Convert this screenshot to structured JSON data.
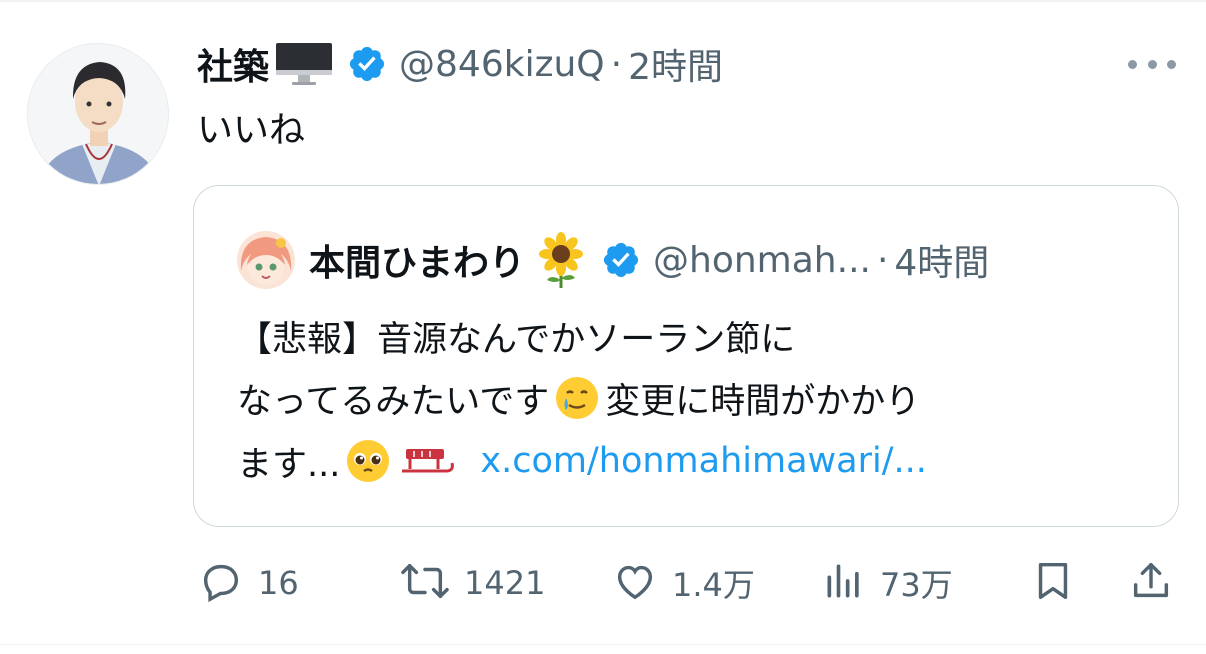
{
  "tweet": {
    "author_name": "社築",
    "author_handle": "@846kizuQ",
    "separator": "·",
    "time": "2時間",
    "text": "いいね"
  },
  "quote": {
    "author_name": "本間ひまわり",
    "author_handle": "@honmah...",
    "separator": "·",
    "time": "4時間",
    "line1": "【悲報】音源なんでかソーラン節に",
    "line2_text": "なってるみたいです",
    "line2_after": "変更に時間がかかり",
    "line3_text": "ます...",
    "link": "x.com/honmahimawari/..."
  },
  "actions": {
    "reply_count": "16",
    "retweet_count": "1421",
    "like_count": "1.4万",
    "views_count": "73万"
  },
  "icons": {
    "verified": "verified-badge-icon",
    "monitor": "desktop-computer-emoji",
    "sunflower": "sunflower-emoji",
    "more": "more-horizontal-icon",
    "reply": "reply-icon",
    "retweet": "retweet-icon",
    "like": "heart-icon",
    "views": "views-chart-icon",
    "bookmark": "bookmark-icon",
    "share": "share-icon"
  },
  "colors": {
    "verified": "#1d9bf0",
    "link": "#1d9bf0",
    "secondary_text": "#536471",
    "border": "#cfd9de"
  }
}
